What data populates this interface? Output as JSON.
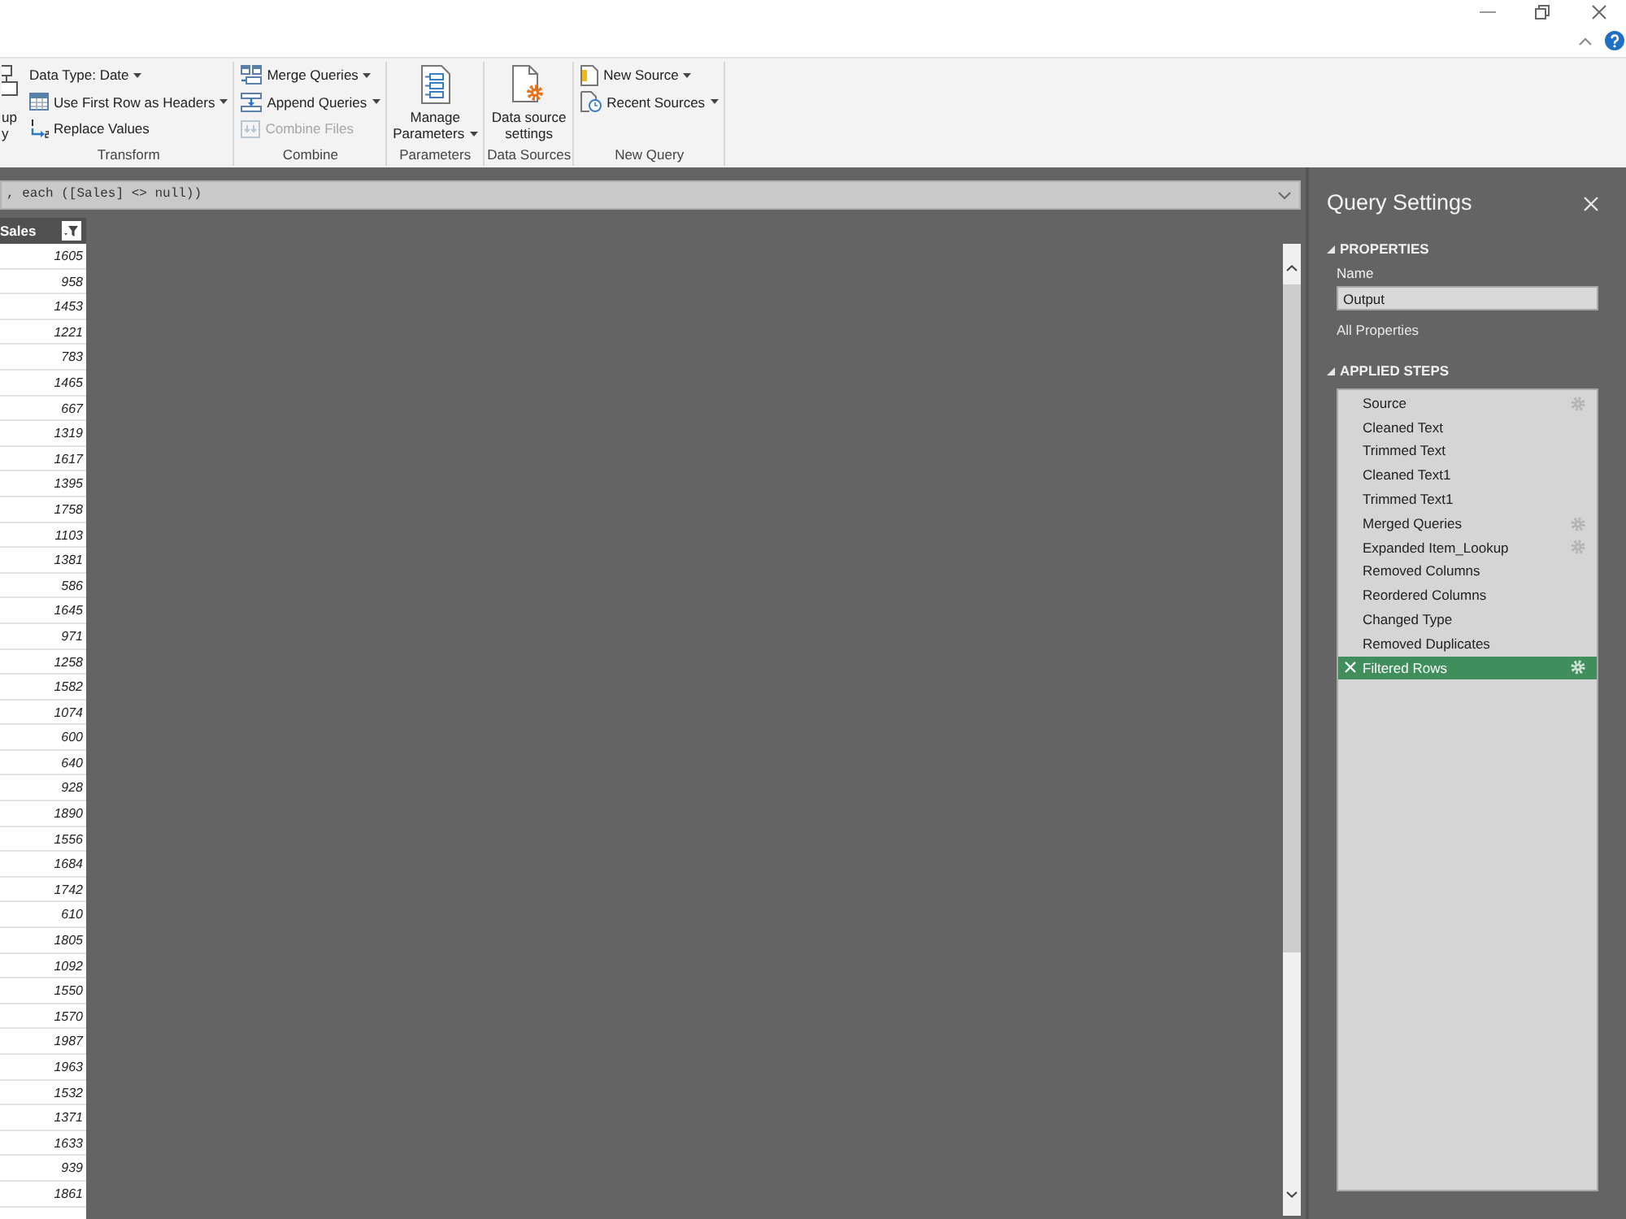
{
  "ribbon": {
    "groups": [
      {
        "items": [
          {
            "kind": "large",
            "lines": [
              "up",
              "y"
            ],
            "dropdown": false,
            "disabled": false
          }
        ]
      },
      {
        "label": "Transform",
        "items": [
          {
            "kind": "small",
            "text": "Data Type: Date",
            "dropdown": true,
            "disabled": false
          },
          {
            "kind": "small",
            "text": "Use First Row as Headers",
            "dropdown": true,
            "disabled": false
          },
          {
            "kind": "small",
            "text": "Replace Values",
            "dropdown": false,
            "disabled": false
          }
        ]
      },
      {
        "label": "Combine",
        "items": [
          {
            "kind": "small",
            "text": "Merge Queries",
            "dropdown": true,
            "disabled": false
          },
          {
            "kind": "small",
            "text": "Append Queries",
            "dropdown": true,
            "disabled": false
          },
          {
            "kind": "small",
            "text": "Combine Files",
            "dropdown": false,
            "disabled": true
          }
        ]
      },
      {
        "label": "Parameters",
        "items": [
          {
            "kind": "large",
            "lines": [
              "Manage",
              "Parameters"
            ],
            "dropdown": true,
            "disabled": false
          }
        ]
      },
      {
        "label": "Data Sources",
        "items": [
          {
            "kind": "large",
            "lines": [
              "Data source",
              "settings"
            ],
            "dropdown": false,
            "disabled": false
          }
        ]
      },
      {
        "label": "New Query",
        "items": [
          {
            "kind": "small",
            "text": "New Source",
            "dropdown": true,
            "disabled": false
          },
          {
            "kind": "small",
            "text": "Recent Sources",
            "dropdown": true,
            "disabled": false
          }
        ]
      }
    ]
  },
  "formula_bar": {
    "text": ", each ([Sales] <> null))"
  },
  "table": {
    "column": {
      "header": "Sales",
      "values": [
        "1605",
        "958",
        "1453",
        "1221",
        "783",
        "1465",
        "667",
        "1319",
        "1617",
        "1395",
        "1758",
        "1103",
        "1381",
        "586",
        "1645",
        "971",
        "1258",
        "1582",
        "1074",
        "600",
        "640",
        "928",
        "1890",
        "1556",
        "1684",
        "1742",
        "610",
        "1805",
        "1092",
        "1550",
        "1570",
        "1987",
        "1963",
        "1532",
        "1371",
        "1633",
        "939",
        "1861"
      ]
    }
  },
  "query_settings": {
    "title": "Query Settings",
    "properties": {
      "heading": "PROPERTIES",
      "expanded": true,
      "name_label": "Name",
      "name_value": "Output",
      "link": "All Properties"
    },
    "applied_steps": {
      "heading": "APPLIED STEPS",
      "expanded": true,
      "steps": [
        {
          "label": "Source",
          "selected": false,
          "settings": true
        },
        {
          "label": "Cleaned Text",
          "selected": false,
          "settings": false
        },
        {
          "label": "Trimmed Text",
          "selected": false,
          "settings": false
        },
        {
          "label": "Cleaned Text1",
          "selected": false,
          "settings": false
        },
        {
          "label": "Trimmed Text1",
          "selected": false,
          "settings": false
        },
        {
          "label": "Merged Queries",
          "selected": false,
          "settings": true
        },
        {
          "label": "Expanded Item_Lookup",
          "selected": false,
          "settings": true
        },
        {
          "label": "Removed Columns",
          "selected": false,
          "settings": false
        },
        {
          "label": "Reordered Columns",
          "selected": false,
          "settings": false
        },
        {
          "label": "Changed Type",
          "selected": false,
          "settings": false
        },
        {
          "label": "Removed Duplicates",
          "selected": false,
          "settings": false
        },
        {
          "label": "Filtered Rows",
          "selected": true,
          "settings": true
        }
      ]
    }
  }
}
